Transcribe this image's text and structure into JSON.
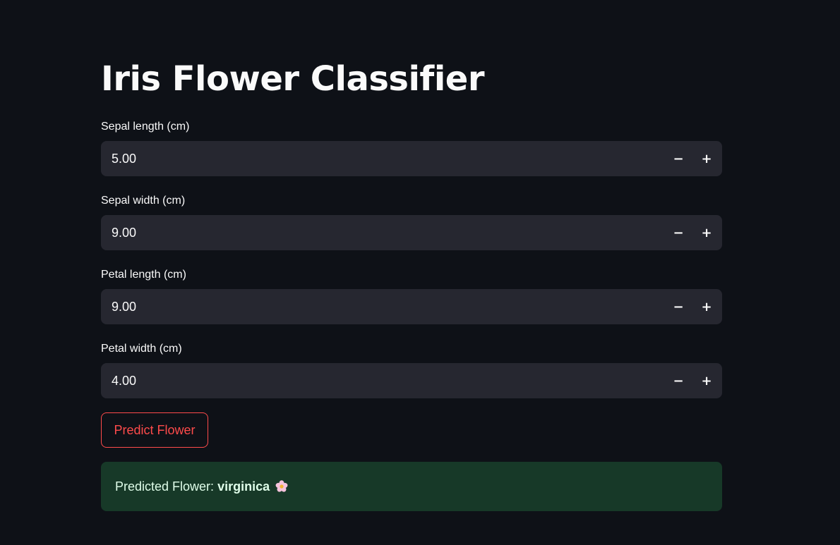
{
  "title": "Iris Flower Classifier",
  "fields": [
    {
      "label": "Sepal length (cm)",
      "value": "5.00",
      "decrement": "−",
      "increment": "+"
    },
    {
      "label": "Sepal width (cm)",
      "value": "9.00",
      "decrement": "−",
      "increment": "+"
    },
    {
      "label": "Petal length (cm)",
      "value": "9.00",
      "decrement": "−",
      "increment": "+"
    },
    {
      "label": "Petal width (cm)",
      "value": "4.00",
      "decrement": "−",
      "increment": "+"
    }
  ],
  "predict_button": {
    "label": "Predict Flower"
  },
  "result": {
    "prefix": "Predicted Flower:",
    "value": "virginica",
    "icon": "cherry-blossom-icon"
  },
  "colors": {
    "background": "#0e1117",
    "input_bg": "#262730",
    "accent": "#ff4b4b",
    "success_bg": "#173928",
    "success_text": "#dffde9"
  }
}
